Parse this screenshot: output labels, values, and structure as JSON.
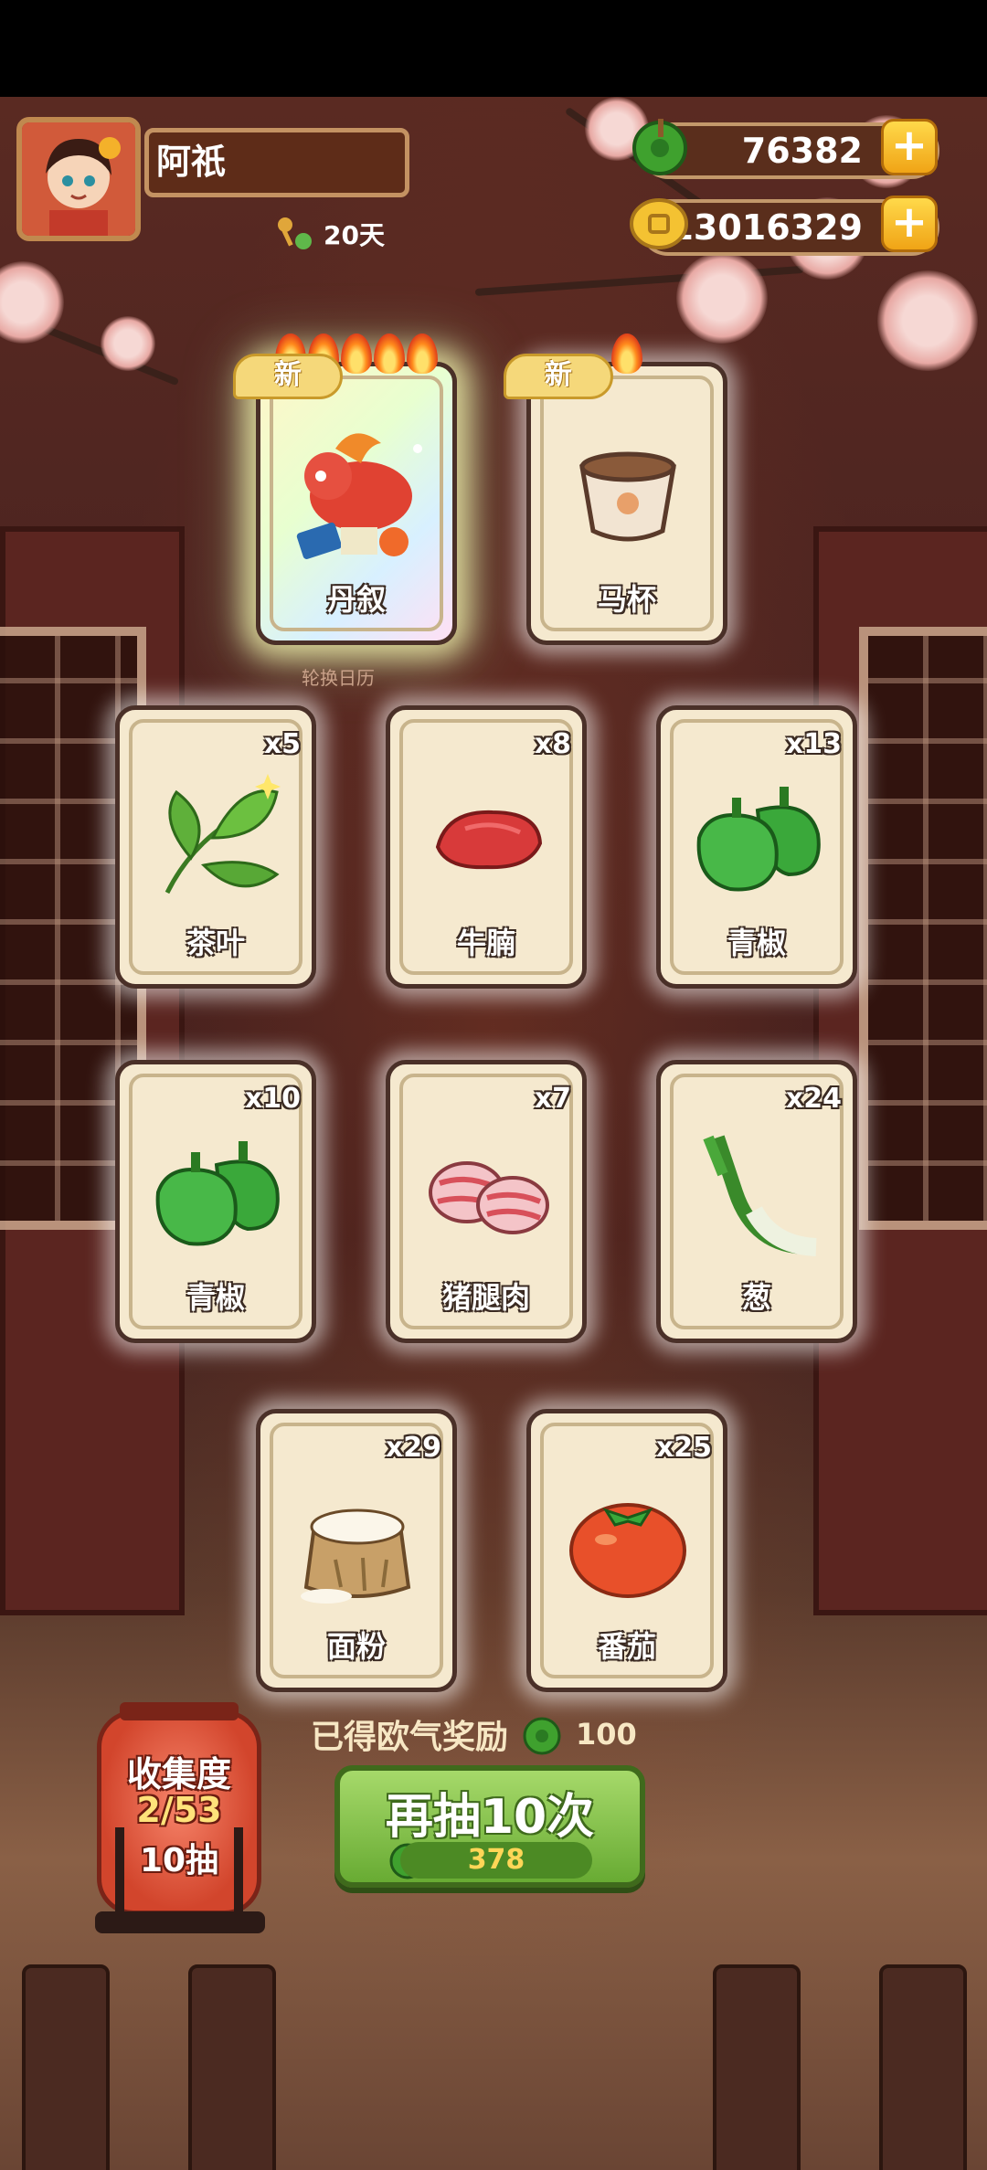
{
  "player": {
    "name": "阿祇",
    "days": "20天"
  },
  "currencies": {
    "jade": "76382",
    "coins": "13016329"
  },
  "colors": {
    "accent_green": "#68ab33",
    "gold": "#f0a416",
    "card_bg": "#f5e9cf"
  },
  "new_tag": "新",
  "calendar_label": "轮换日历",
  "featured_cards": [
    {
      "label": "丹叙",
      "is_new": true,
      "flames": 5,
      "icon": "red-beast-icon"
    },
    {
      "label": "马杯",
      "is_new": true,
      "flames": 1,
      "icon": "cup-icon"
    }
  ],
  "item_cards": [
    {
      "label": "茶叶",
      "count": "x5",
      "icon": "tea-leaf-icon"
    },
    {
      "label": "牛腩",
      "count": "x8",
      "icon": "beef-icon"
    },
    {
      "label": "青椒",
      "count": "x13",
      "icon": "green-pepper-icon"
    },
    {
      "label": "青椒",
      "count": "x10",
      "icon": "green-pepper-icon"
    },
    {
      "label": "猪腿肉",
      "count": "x7",
      "icon": "pork-icon"
    },
    {
      "label": "葱",
      "count": "x24",
      "icon": "scallion-icon"
    },
    {
      "label": "面粉",
      "count": "x29",
      "icon": "flour-sack-icon"
    },
    {
      "label": "番茄",
      "count": "x25",
      "icon": "tomato-icon"
    }
  ],
  "reward": {
    "text": "已得欧气奖励",
    "amount": "100"
  },
  "draw_button": {
    "label": "再抽10次",
    "cost": "378"
  },
  "collection": {
    "title": "收集度",
    "progress": "2/53",
    "draws": "10抽"
  }
}
